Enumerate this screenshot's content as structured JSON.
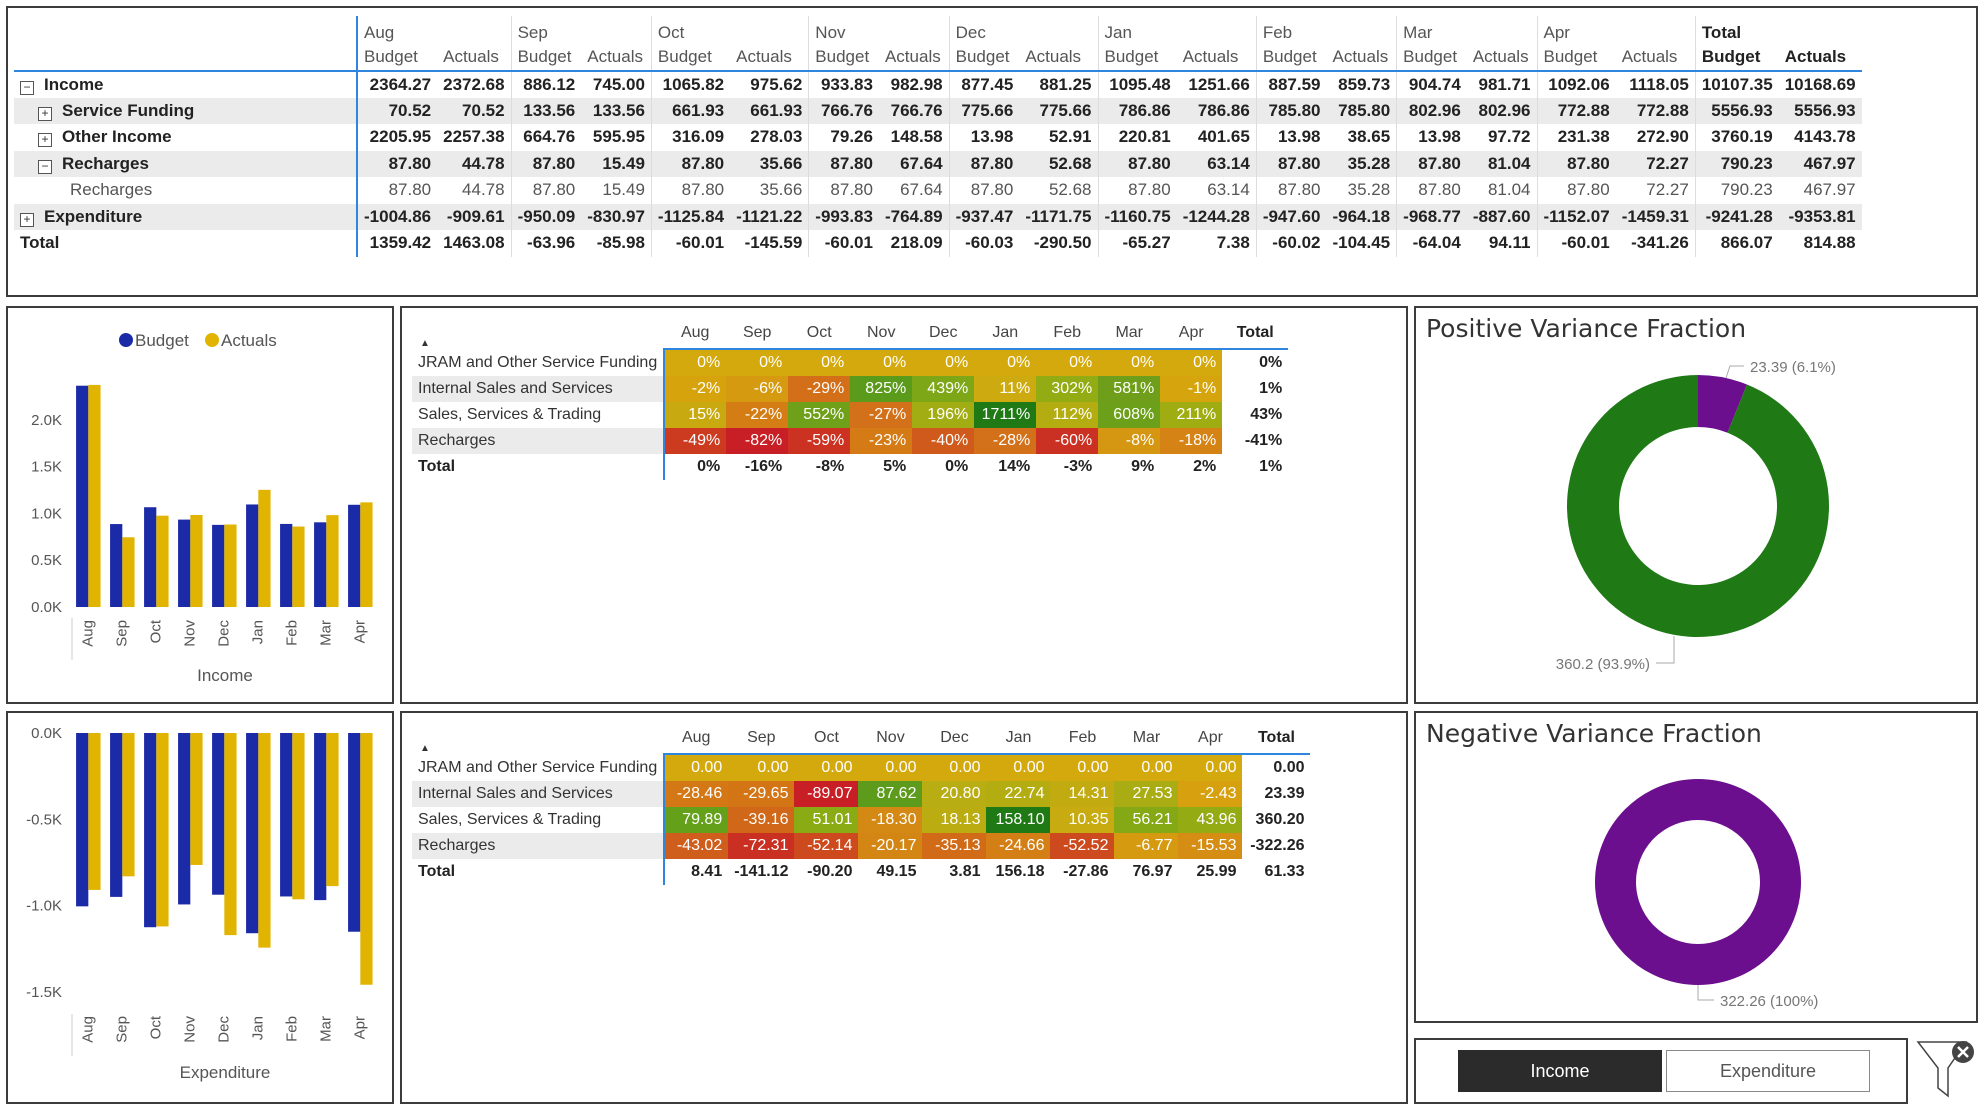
{
  "matrix": {
    "months": [
      "Aug",
      "Sep",
      "Oct",
      "Nov",
      "Dec",
      "Jan",
      "Feb",
      "Mar",
      "Apr"
    ],
    "total_label": "Total",
    "budget_label": "Budget",
    "actuals_label": "Actuals",
    "rows": [
      {
        "label": "Income",
        "style": "bold",
        "expander": "−",
        "values": [
          "2364.27",
          "2372.68",
          "886.12",
          "745.00",
          "1065.82",
          "975.62",
          "933.83",
          "982.98",
          "877.45",
          "881.25",
          "1095.48",
          "1251.66",
          "887.59",
          "859.73",
          "904.74",
          "981.71",
          "1092.06",
          "1118.05",
          "10107.35",
          "10168.69"
        ]
      },
      {
        "label": "Service Funding",
        "style": "bold shade",
        "expander": "+",
        "indent": 1,
        "values": [
          "70.52",
          "70.52",
          "133.56",
          "133.56",
          "661.93",
          "661.93",
          "766.76",
          "766.76",
          "775.66",
          "775.66",
          "786.86",
          "786.86",
          "785.80",
          "785.80",
          "802.96",
          "802.96",
          "772.88",
          "772.88",
          "5556.93",
          "5556.93"
        ]
      },
      {
        "label": "Other Income",
        "style": "bold",
        "expander": "+",
        "indent": 1,
        "values": [
          "2205.95",
          "2257.38",
          "664.76",
          "595.95",
          "316.09",
          "278.03",
          "79.26",
          "148.58",
          "13.98",
          "52.91",
          "220.81",
          "401.65",
          "13.98",
          "38.65",
          "13.98",
          "97.72",
          "231.38",
          "272.90",
          "3760.19",
          "4143.78"
        ]
      },
      {
        "label": "Recharges",
        "style": "bold shade",
        "expander": "−",
        "indent": 1,
        "values": [
          "87.80",
          "44.78",
          "87.80",
          "15.49",
          "87.80",
          "35.66",
          "87.80",
          "67.64",
          "87.80",
          "52.68",
          "87.80",
          "63.14",
          "87.80",
          "35.28",
          "87.80",
          "81.04",
          "87.80",
          "72.27",
          "790.23",
          "467.97"
        ]
      },
      {
        "label": "Recharges",
        "style": "sub",
        "indent": 2,
        "values": [
          "87.80",
          "44.78",
          "87.80",
          "15.49",
          "87.80",
          "35.66",
          "87.80",
          "67.64",
          "87.80",
          "52.68",
          "87.80",
          "63.14",
          "87.80",
          "35.28",
          "87.80",
          "81.04",
          "87.80",
          "72.27",
          "790.23",
          "467.97"
        ]
      },
      {
        "label": "Expenditure",
        "style": "bold shade",
        "expander": "+",
        "values": [
          "-1004.86",
          "-909.61",
          "-950.09",
          "-830.97",
          "-1125.84",
          "-1121.22",
          "-993.83",
          "-764.89",
          "-937.47",
          "-1171.75",
          "-1160.75",
          "-1244.28",
          "-947.60",
          "-964.18",
          "-968.77",
          "-887.60",
          "-1152.07",
          "-1459.31",
          "-9241.28",
          "-9353.81"
        ]
      },
      {
        "label": "Total",
        "style": "bold",
        "values": [
          "1359.42",
          "1463.08",
          "-63.96",
          "-85.98",
          "-60.01",
          "-145.59",
          "-60.01",
          "218.09",
          "-60.03",
          "-290.50",
          "-65.27",
          "7.38",
          "-60.02",
          "-104.45",
          "-64.04",
          "94.11",
          "-60.01",
          "-341.26",
          "866.07",
          "814.88"
        ]
      }
    ]
  },
  "income_chart": {
    "chart_data": {
      "type": "bar",
      "categories": [
        "Aug",
        "Sep",
        "Oct",
        "Nov",
        "Dec",
        "Jan",
        "Feb",
        "Mar",
        "Apr"
      ],
      "series": [
        {
          "name": "Budget",
          "color": "#1b2aa6",
          "values": [
            2364.27,
            886.12,
            1065.82,
            933.83,
            877.45,
            1095.48,
            887.59,
            904.74,
            1092.06
          ]
        },
        {
          "name": "Actuals",
          "color": "#e0b400",
          "values": [
            2372.68,
            745.0,
            975.62,
            982.98,
            881.25,
            1251.66,
            859.73,
            981.71,
            1118.05
          ]
        }
      ],
      "xlabel": "Income",
      "ylim": [
        0,
        2500
      ],
      "yticks": [
        "0.0K",
        "0.5K",
        "1.0K",
        "1.5K",
        "2.0K"
      ],
      "legend": "top"
    }
  },
  "expenditure_chart": {
    "chart_data": {
      "type": "bar",
      "categories": [
        "Aug",
        "Sep",
        "Oct",
        "Nov",
        "Dec",
        "Jan",
        "Feb",
        "Mar",
        "Apr"
      ],
      "series": [
        {
          "name": "Budget",
          "color": "#1b2aa6",
          "values": [
            -1004.86,
            -950.09,
            -1125.84,
            -993.83,
            -937.47,
            -1160.75,
            -947.6,
            -968.77,
            -1152.07
          ]
        },
        {
          "name": "Actuals",
          "color": "#e0b400",
          "values": [
            -909.61,
            -830.97,
            -1121.22,
            -764.89,
            -1171.75,
            -1244.28,
            -964.18,
            -887.6,
            -1459.31
          ]
        }
      ],
      "xlabel": "Expenditure",
      "ylim": [
        -1600,
        0
      ],
      "yticks": [
        "0.0K",
        "-0.5K",
        "-1.0K",
        "-1.5K"
      ]
    }
  },
  "pct_table": {
    "months": [
      "Aug",
      "Sep",
      "Oct",
      "Nov",
      "Dec",
      "Jan",
      "Feb",
      "Mar",
      "Apr"
    ],
    "total_label": "Total",
    "sort_indicator": "▲",
    "rows": [
      {
        "label": "JRAM and Other Service Funding",
        "cells": [
          {
            "v": "0%",
            "c": "#d4a90d"
          },
          {
            "v": "0%",
            "c": "#d4a90d"
          },
          {
            "v": "0%",
            "c": "#d4a90d"
          },
          {
            "v": "0%",
            "c": "#d4a90d"
          },
          {
            "v": "0%",
            "c": "#d4a90d"
          },
          {
            "v": "0%",
            "c": "#d4a90d"
          },
          {
            "v": "0%",
            "c": "#d4a90d"
          },
          {
            "v": "0%",
            "c": "#d4a90d"
          },
          {
            "v": "0%",
            "c": "#d4a90d"
          }
        ],
        "total": "0%"
      },
      {
        "label": "Internal Sales and Services",
        "cells": [
          {
            "v": "-2%",
            "c": "#d7a30d"
          },
          {
            "v": "-6%",
            "c": "#d69a10"
          },
          {
            "v": "-29%",
            "c": "#d36e19"
          },
          {
            "v": "825%",
            "c": "#5b9b1c"
          },
          {
            "v": "439%",
            "c": "#7da717"
          },
          {
            "v": "11%",
            "c": "#cdaa10"
          },
          {
            "v": "302%",
            "c": "#94ac14"
          },
          {
            "v": "581%",
            "c": "#6f9f1a"
          },
          {
            "v": "-1%",
            "c": "#d6a50d"
          }
        ],
        "total": "1%"
      },
      {
        "label": "Sales, Services & Trading",
        "cells": [
          {
            "v": "15%",
            "c": "#c8aa10"
          },
          {
            "v": "-22%",
            "c": "#d47d15"
          },
          {
            "v": "552%",
            "c": "#6fa01a"
          },
          {
            "v": "-27%",
            "c": "#d3711a"
          },
          {
            "v": "196%",
            "c": "#a1ad13"
          },
          {
            "v": "1711%",
            "c": "#1f7a16"
          },
          {
            "v": "112%",
            "c": "#b3ad12"
          },
          {
            "v": "608%",
            "c": "#6c9f1a"
          },
          {
            "v": "211%",
            "c": "#9fad13"
          }
        ],
        "total": "43%"
      },
      {
        "label": "Recharges",
        "cells": [
          {
            "v": "-49%",
            "c": "#cc3a20"
          },
          {
            "v": "-82%",
            "c": "#c71f25"
          },
          {
            "v": "-59%",
            "c": "#cb3222"
          },
          {
            "v": "-23%",
            "c": "#d47b15"
          },
          {
            "v": "-40%",
            "c": "#cf5a1c"
          },
          {
            "v": "-28%",
            "c": "#d3701a"
          },
          {
            "v": "-60%",
            "c": "#cb3122"
          },
          {
            "v": "-8%",
            "c": "#d59611"
          },
          {
            "v": "-18%",
            "c": "#d48314"
          }
        ],
        "total": "-41%"
      }
    ],
    "totals": [
      "0%",
      "-16%",
      "-8%",
      "5%",
      "0%",
      "14%",
      "-3%",
      "9%",
      "2%"
    ],
    "grand_total": "1%",
    "total_row_label": "Total"
  },
  "abs_table": {
    "months": [
      "Aug",
      "Sep",
      "Oct",
      "Nov",
      "Dec",
      "Jan",
      "Feb",
      "Mar",
      "Apr"
    ],
    "total_label": "Total",
    "sort_indicator": "▲",
    "rows": [
      {
        "label": "JRAM and Other Service Funding",
        "cells": [
          {
            "v": "0.00",
            "c": "#d4a90d"
          },
          {
            "v": "0.00",
            "c": "#d4a90d"
          },
          {
            "v": "0.00",
            "c": "#d4a90d"
          },
          {
            "v": "0.00",
            "c": "#d4a90d"
          },
          {
            "v": "0.00",
            "c": "#d4a90d"
          },
          {
            "v": "0.00",
            "c": "#d4a90d"
          },
          {
            "v": "0.00",
            "c": "#d4a90d"
          },
          {
            "v": "0.00",
            "c": "#d4a90d"
          },
          {
            "v": "0.00",
            "c": "#d4a90d"
          }
        ],
        "total": "0.00"
      },
      {
        "label": "Internal Sales and Services",
        "cells": [
          {
            "v": "-28.46",
            "c": "#d47815"
          },
          {
            "v": "-29.65",
            "c": "#d47515"
          },
          {
            "v": "-89.07",
            "c": "#c71f25"
          },
          {
            "v": "87.62",
            "c": "#5c9b1c"
          },
          {
            "v": "20.80",
            "c": "#b8ad12"
          },
          {
            "v": "22.74",
            "c": "#b4ad12"
          },
          {
            "v": "14.31",
            "c": "#c2ab11"
          },
          {
            "v": "27.53",
            "c": "#a9ad13"
          },
          {
            "v": "-2.43",
            "c": "#d6a00e"
          }
        ],
        "total": "23.39"
      },
      {
        "label": "Sales, Services & Trading",
        "cells": [
          {
            "v": "79.89",
            "c": "#64a01a"
          },
          {
            "v": "-39.16",
            "c": "#d06719"
          },
          {
            "v": "51.01",
            "c": "#8bab14"
          },
          {
            "v": "-18.30",
            "c": "#d48914"
          },
          {
            "v": "18.13",
            "c": "#bbac12"
          },
          {
            "v": "158.10",
            "c": "#1f7a16"
          },
          {
            "v": "10.35",
            "c": "#c7ab10"
          },
          {
            "v": "56.21",
            "c": "#85a915"
          },
          {
            "v": "43.96",
            "c": "#94ab14"
          }
        ],
        "total": "360.20"
      },
      {
        "label": "Recharges",
        "cells": [
          {
            "v": "-43.02",
            "c": "#cf5d1b"
          },
          {
            "v": "-72.31",
            "c": "#c93022"
          },
          {
            "v": "-52.14",
            "c": "#cd4a1e"
          },
          {
            "v": "-20.17",
            "c": "#d48614"
          },
          {
            "v": "-35.13",
            "c": "#d16b18"
          },
          {
            "v": "-24.66",
            "c": "#d47f15"
          },
          {
            "v": "-52.52",
            "c": "#cd4a1e"
          },
          {
            "v": "-6.77",
            "c": "#d69a10"
          },
          {
            "v": "-15.53",
            "c": "#d58d13"
          }
        ],
        "total": "-322.26"
      }
    ],
    "totals": [
      "8.41",
      "-141.12",
      "-90.20",
      "49.15",
      "3.81",
      "156.18",
      "-27.86",
      "76.97",
      "25.99"
    ],
    "grand_total": "61.33",
    "total_row_label": "Total"
  },
  "positive_donut": {
    "title": "Positive Variance Fraction",
    "chart_data": {
      "type": "pie",
      "values": [
        23.39,
        360.2
      ],
      "colors": [
        "#6b0f8e",
        "#1f7a16"
      ],
      "labels": [
        "23.39 (6.1%)",
        "360.2 (93.9%)"
      ]
    }
  },
  "negative_donut": {
    "title": "Negative Variance Fraction",
    "chart_data": {
      "type": "pie",
      "values": [
        322.26
      ],
      "colors": [
        "#6b0f8e"
      ],
      "labels": [
        "322.26 (100%)"
      ]
    }
  },
  "slicer": {
    "income": "Income",
    "expenditure": "Expenditure",
    "selected": "Income"
  }
}
